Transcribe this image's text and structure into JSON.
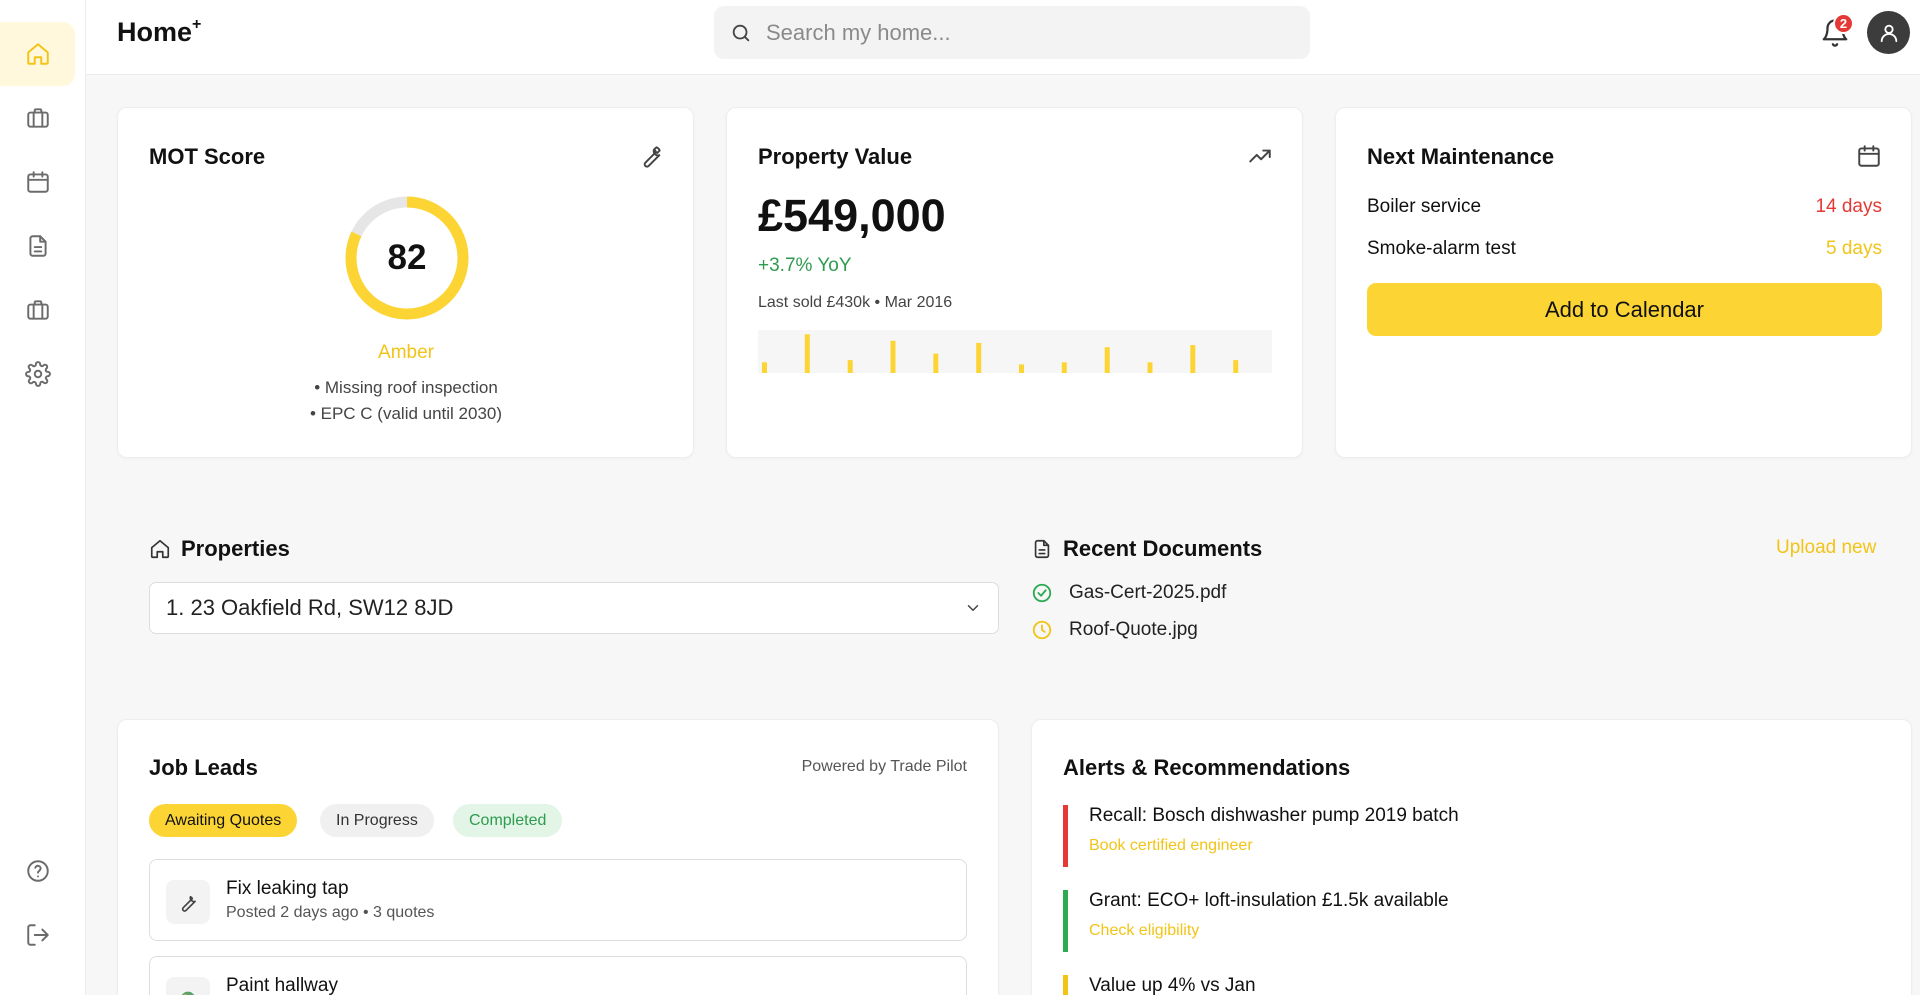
{
  "app": {
    "logo": "Home",
    "logo_mark": "+"
  },
  "search": {
    "placeholder": "Search my home..."
  },
  "notifications": {
    "count": "2"
  },
  "sidebar": {
    "items": [
      {
        "icon": "home-icon"
      },
      {
        "icon": "briefcase-icon"
      },
      {
        "icon": "calendar-icon"
      },
      {
        "icon": "document-icon"
      },
      {
        "icon": "suitcase-icon"
      },
      {
        "icon": "gear-icon"
      },
      {
        "icon": "help-icon"
      },
      {
        "icon": "logout-icon"
      }
    ]
  },
  "mot": {
    "title": "MOT Score",
    "score": "82",
    "score_value": 82,
    "band": "Amber",
    "notes": [
      "• Missing roof inspection",
      "• EPC C (valid until 2030)"
    ]
  },
  "property": {
    "title": "Property Value",
    "value": "£549,000",
    "yoy": "+3.7% YoY",
    "last_sold": "Last sold £430k • Mar 2016"
  },
  "chart_data": {
    "type": "bar",
    "title": "",
    "xlabel": "",
    "ylabel": "",
    "values": [
      0.25,
      0.9,
      0.3,
      0.75,
      0.45,
      0.7,
      0.2,
      0.25,
      0.6,
      0.25,
      0.65,
      0.3
    ]
  },
  "maintenance": {
    "title": "Next Maintenance",
    "items": [
      {
        "task": "Boiler service",
        "due": "14 days",
        "status": "red"
      },
      {
        "task": "Smoke-alarm test",
        "due": "5 days",
        "status": "amber"
      }
    ],
    "button": "Add to Calendar"
  },
  "properties": {
    "title": "Properties",
    "selected": "1. 23 Oakfield Rd, SW12 8JD"
  },
  "documents": {
    "title": "Recent Documents",
    "upload": "Upload new",
    "items": [
      {
        "name": "Gas-Cert-2025.pdf",
        "status": "done"
      },
      {
        "name": "Roof-Quote.jpg",
        "status": "pending"
      }
    ]
  },
  "jobs": {
    "title": "Job Leads",
    "powered": "Powered by Trade Pilot",
    "tabs": [
      "Awaiting Quotes",
      "In Progress",
      "Completed"
    ],
    "items": [
      {
        "title": "Fix leaking tap",
        "meta": "Posted 2 days ago • 3 quotes",
        "icon": "wrench-icon"
      },
      {
        "title": "Paint hallway",
        "meta": "",
        "icon": "paint-icon"
      }
    ]
  },
  "alerts": {
    "title": "Alerts & Recommendations",
    "items": [
      {
        "title": "Recall: Bosch dishwasher pump 2019 batch",
        "action": "Book certified engineer",
        "color": "#e53935"
      },
      {
        "title": "Grant: ECO+ loft-insulation £1.5k available",
        "action": "Check eligibility",
        "color": "#2eaa55"
      },
      {
        "title": "Value up 4% vs Jan",
        "action": "",
        "color": "#f2c418"
      }
    ]
  },
  "colors": {
    "accent": "#fcd535",
    "amber": "#f2c418",
    "red": "#e53935",
    "green": "#2e9b4f"
  }
}
